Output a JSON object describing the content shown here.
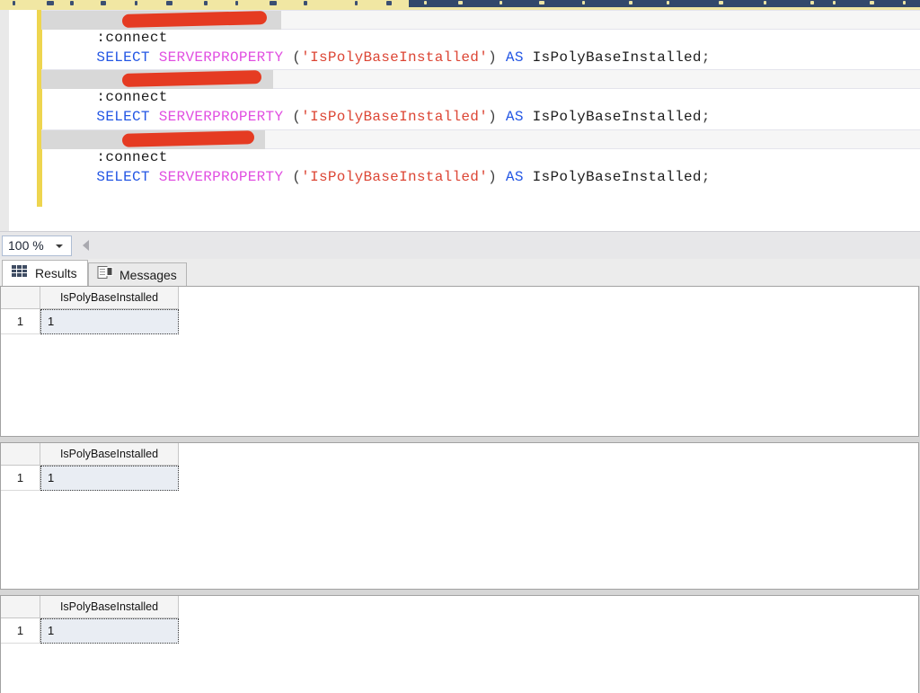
{
  "editor": {
    "connect_command": ":connect",
    "statement": {
      "select_kw": "SELECT ",
      "function_name": "SERVERPROPERTY ",
      "paren_open": "(",
      "string_literal": "'IsPolyBaseInstalled'",
      "paren_close": ") ",
      "as_kw": "AS ",
      "alias": "IsPolyBaseInstalled",
      "semicolon": ";"
    },
    "syntax_colors": {
      "keyword": "#2356e4",
      "function": "#e14fe1",
      "string": "#dc4534",
      "identifier": "#1d1d1d",
      "punctuation": "#3d3d3d"
    },
    "redaction_color": "#e53b22",
    "change_tracking_color": "#eed54f"
  },
  "zoom_control": {
    "value": "100 %"
  },
  "results_pane": {
    "tabs": [
      {
        "label": "Results",
        "active": true
      },
      {
        "label": "Messages",
        "active": false
      }
    ],
    "grids": [
      {
        "column_header": "IsPolyBaseInstalled",
        "row_number": "1",
        "value": "1"
      },
      {
        "column_header": "IsPolyBaseInstalled",
        "row_number": "1",
        "value": "1"
      },
      {
        "column_header": "IsPolyBaseInstalled",
        "row_number": "1",
        "value": "1"
      }
    ]
  }
}
